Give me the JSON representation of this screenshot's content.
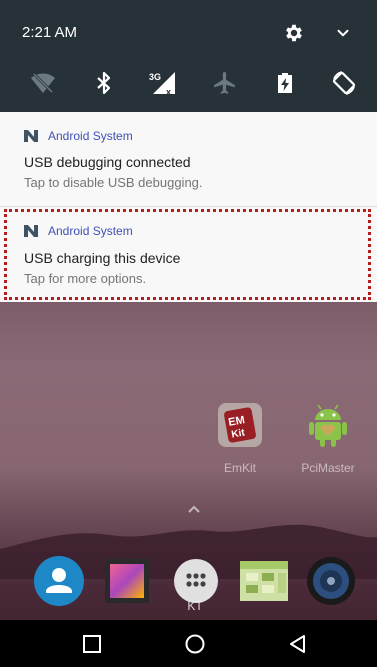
{
  "status": {
    "time": "2:21 AM"
  },
  "quick_settings": [
    {
      "icon": "wifi-off-icon"
    },
    {
      "icon": "bluetooth-icon"
    },
    {
      "icon": "mobile-data-3g-icon",
      "text": "3G"
    },
    {
      "icon": "airplane-mode-icon"
    },
    {
      "icon": "battery-saver-icon"
    },
    {
      "icon": "auto-rotate-icon"
    }
  ],
  "notifications": [
    {
      "app": "Android System",
      "title": "USB debugging connected",
      "subtitle": "Tap to disable USB debugging."
    },
    {
      "app": "Android System",
      "title": "USB charging this device",
      "subtitle": "Tap for more options."
    }
  ],
  "home_apps": [
    {
      "label": "EmKit"
    },
    {
      "label": "PciMaster"
    }
  ],
  "dock": {
    "folder_label": "KT"
  },
  "colors": {
    "shade": "#263238",
    "notification_bg": "#f8f8f8",
    "app_name": "#3f51b5",
    "highlight": "#b71c1c"
  }
}
